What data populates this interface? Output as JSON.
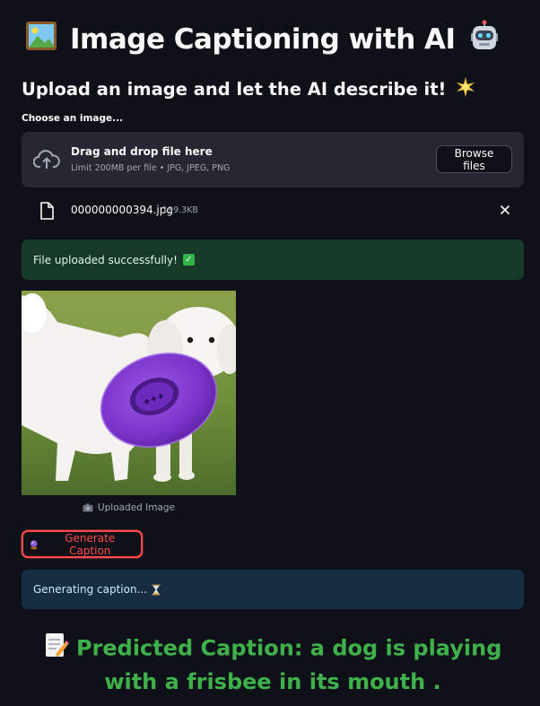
{
  "header": {
    "title": "Image Captioning with AI",
    "title_icon_left": "picture-frame-icon",
    "title_icon_right": "robot-icon"
  },
  "subheader": {
    "text": "Upload an image and let the AI describe it!",
    "icon": "sparkle-star-icon"
  },
  "uploader": {
    "label": "Choose an image...",
    "drop_text": "Drag and drop file here",
    "limit_text": "Limit 200MB per file • JPG, JPEG, PNG",
    "browse_label": "Browse files",
    "icon": "cloud-upload-icon"
  },
  "uploaded_file": {
    "name": "000000000394.jpg",
    "size": "199.3KB",
    "icon": "file-icon",
    "remove_icon": "close-icon"
  },
  "alerts": {
    "success": "File uploaded successfully!",
    "success_icon": "check-mark-icon",
    "info": "Generating caption...",
    "info_icon": "hourglass-icon"
  },
  "image": {
    "caption": "Uploaded Image",
    "caption_icon": "camera-icon"
  },
  "actions": {
    "generate_label": "Generate Caption",
    "generate_icon": "crystal-ball-icon"
  },
  "result": {
    "text": "Predicted Caption: a dog is playing with a frisbee in its mouth .",
    "icon": "memo-icon"
  },
  "colors": {
    "background": "#0e1117",
    "accent": "#ff4b4b",
    "success_bg": "#173928",
    "info_bg": "#172d43",
    "result_text": "#3fb14b"
  }
}
